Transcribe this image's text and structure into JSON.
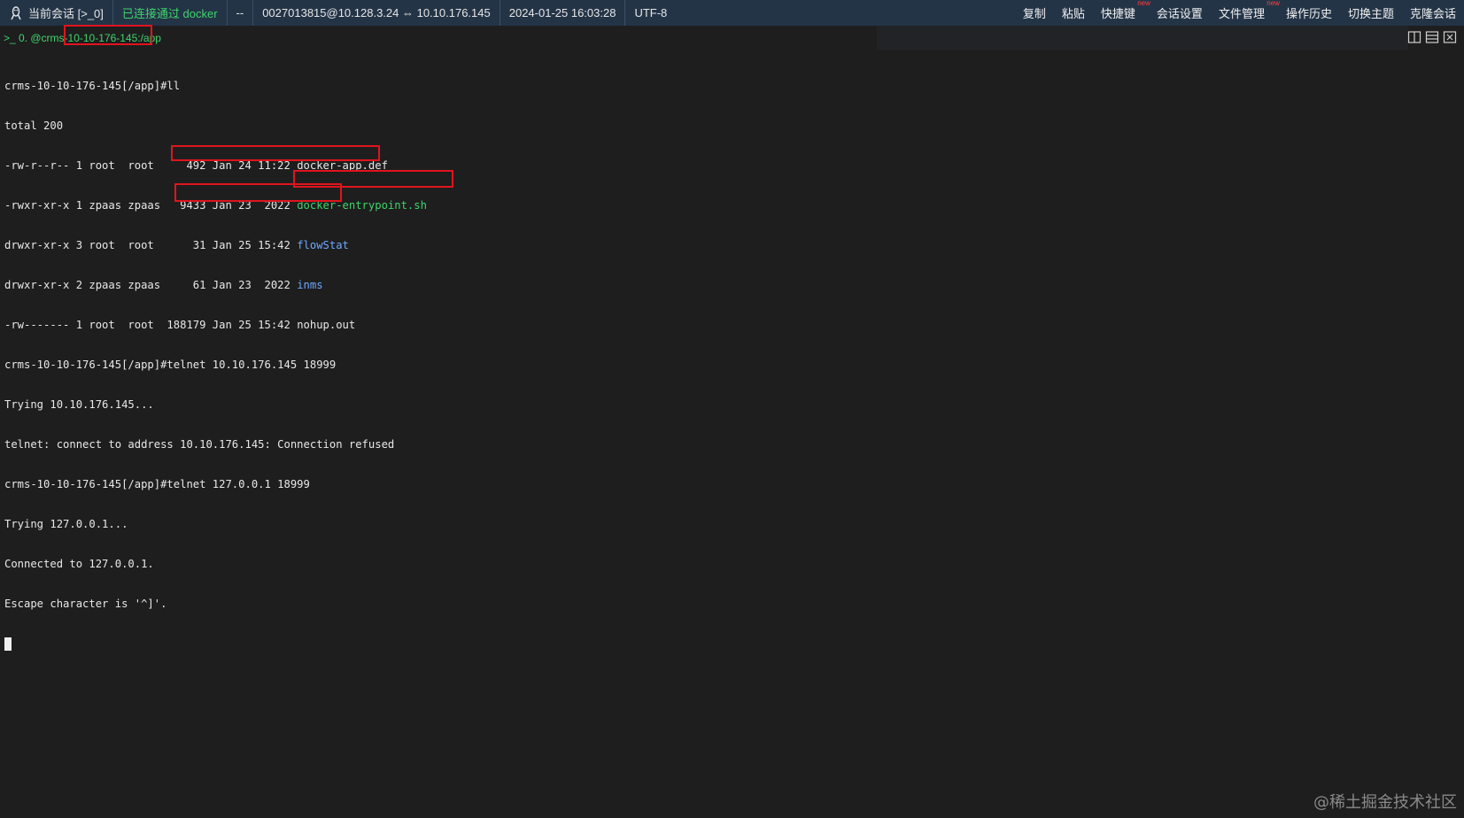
{
  "topbar": {
    "session_label": "当前会话 [>_0]",
    "connection_status": "已连接通过 docker",
    "separator": "--",
    "route": "0027013815@10.128.3.24 ⇔ 10.10.176.145",
    "datetime": "2024-01-25 16:03:28",
    "encoding": "UTF-8",
    "menu": [
      {
        "label": "复制",
        "badge": ""
      },
      {
        "label": "粘贴",
        "badge": ""
      },
      {
        "label": "快捷键",
        "badge": "new"
      },
      {
        "label": "会话设置",
        "badge": ""
      },
      {
        "label": "文件管理",
        "badge": "new"
      },
      {
        "label": "操作历史",
        "badge": ""
      },
      {
        "label": "切换主题",
        "badge": ""
      },
      {
        "label": "克隆会话",
        "badge": ""
      }
    ]
  },
  "pathbar": {
    "text": ">_ 0. @crms-10-10-176-145:/app"
  },
  "terminal": {
    "lines": [
      {
        "text": "crms-10-10-176-145[/app]#ll"
      },
      {
        "text": "total 200"
      },
      {
        "text": "-rw-r--r-- 1 root  root     492 Jan 24 11:22 ",
        "file": "docker-app.def",
        "style": "plain"
      },
      {
        "text": "-rwxr-xr-x 1 zpaas zpaas   9433 Jan 23  2022 ",
        "file": "docker-entrypoint.sh",
        "style": "exec"
      },
      {
        "text": "drwxr-xr-x 3 root  root      31 Jan 25 15:42 ",
        "file": "flowStat",
        "style": "dir"
      },
      {
        "text": "drwxr-xr-x 2 zpaas zpaas     61 Jan 23  2022 ",
        "file": "inms",
        "style": "dir"
      },
      {
        "text": "-rw------- 1 root  root  188179 Jan 25 15:42 ",
        "file": "nohup.out",
        "style": "plain"
      },
      {
        "text": "crms-10-10-176-145[/app]#telnet 10.10.176.145 18999"
      },
      {
        "text": "Trying 10.10.176.145..."
      },
      {
        "text": "telnet: connect to address 10.10.176.145: Connection refused"
      },
      {
        "text": "crms-10-10-176-145[/app]#telnet 127.0.0.1 18999"
      },
      {
        "text": "Trying 127.0.0.1..."
      },
      {
        "text": "Connected to 127.0.0.1."
      },
      {
        "text": "Escape character is '^]'."
      }
    ]
  },
  "watermark": "@稀土掘金技术社区",
  "colors": {
    "topbar_bg": "#243447",
    "terminal_bg": "#1e1e1e",
    "prompt_green": "#3fd46b",
    "dir_blue": "#6ea8ff",
    "highlight_red": "#e0141e"
  },
  "icons": [
    "linux-icon",
    "split-vertical-icon",
    "split-horizontal-icon",
    "close-pane-icon"
  ]
}
